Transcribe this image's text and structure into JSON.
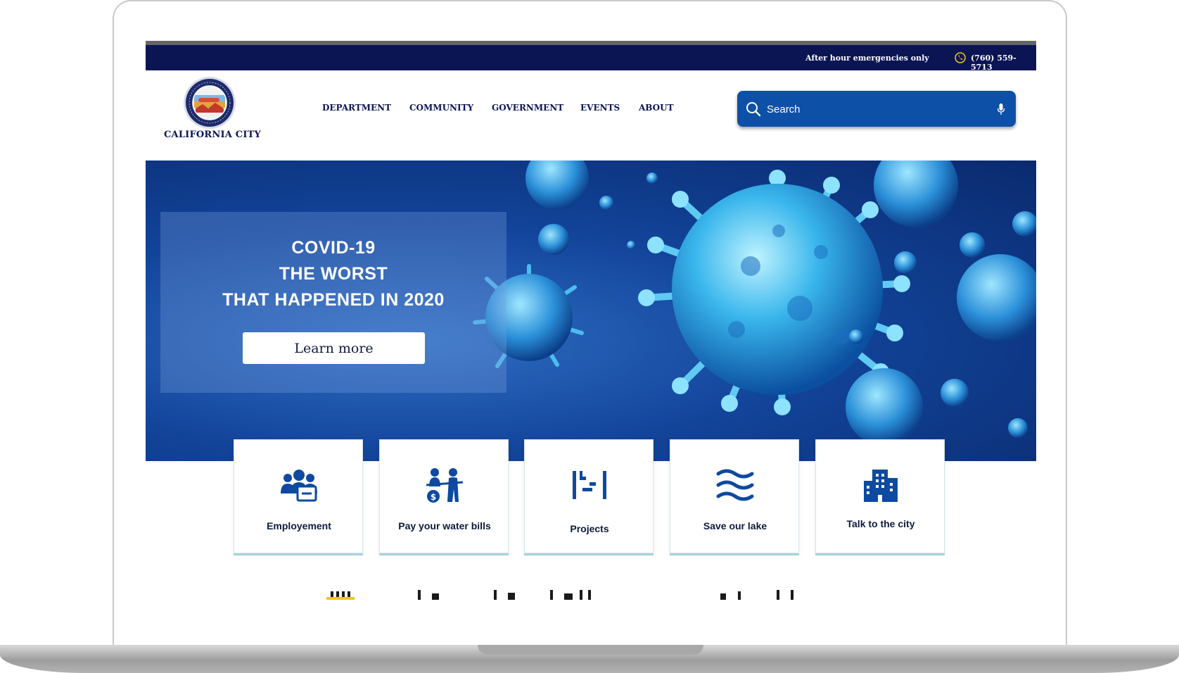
{
  "topbar": {
    "emergency_text": "After hour emergencies only",
    "phone": "(760) 559-5713",
    "phone_icon": "phone-icon"
  },
  "header": {
    "logo_text": "CALIFORNIA CITY",
    "nav": [
      "DEPARTMENT",
      "COMMUNITY",
      "GOVERNMENT",
      "EVENTS",
      "ABOUT"
    ],
    "search_placeholder": "Search"
  },
  "hero": {
    "title": "COVID-19\nTHE WORST\nTHAT  HAPPENED IN 2020",
    "button_label": "Learn more"
  },
  "cards": [
    {
      "label": "Employement",
      "icon": "people-icon"
    },
    {
      "label": "Pay your water bills",
      "icon": "payment-icon"
    },
    {
      "label": "Projects",
      "icon": "projects-icon"
    },
    {
      "label": "Save our lake",
      "icon": "waves-icon"
    },
    {
      "label": "Talk to the city",
      "icon": "city-building-icon"
    }
  ],
  "colors": {
    "navy": "#0b1554",
    "search_blue": "#0d50a8",
    "icon_blue": "#0d4aa0",
    "accent_yellow": "#f5c518"
  }
}
